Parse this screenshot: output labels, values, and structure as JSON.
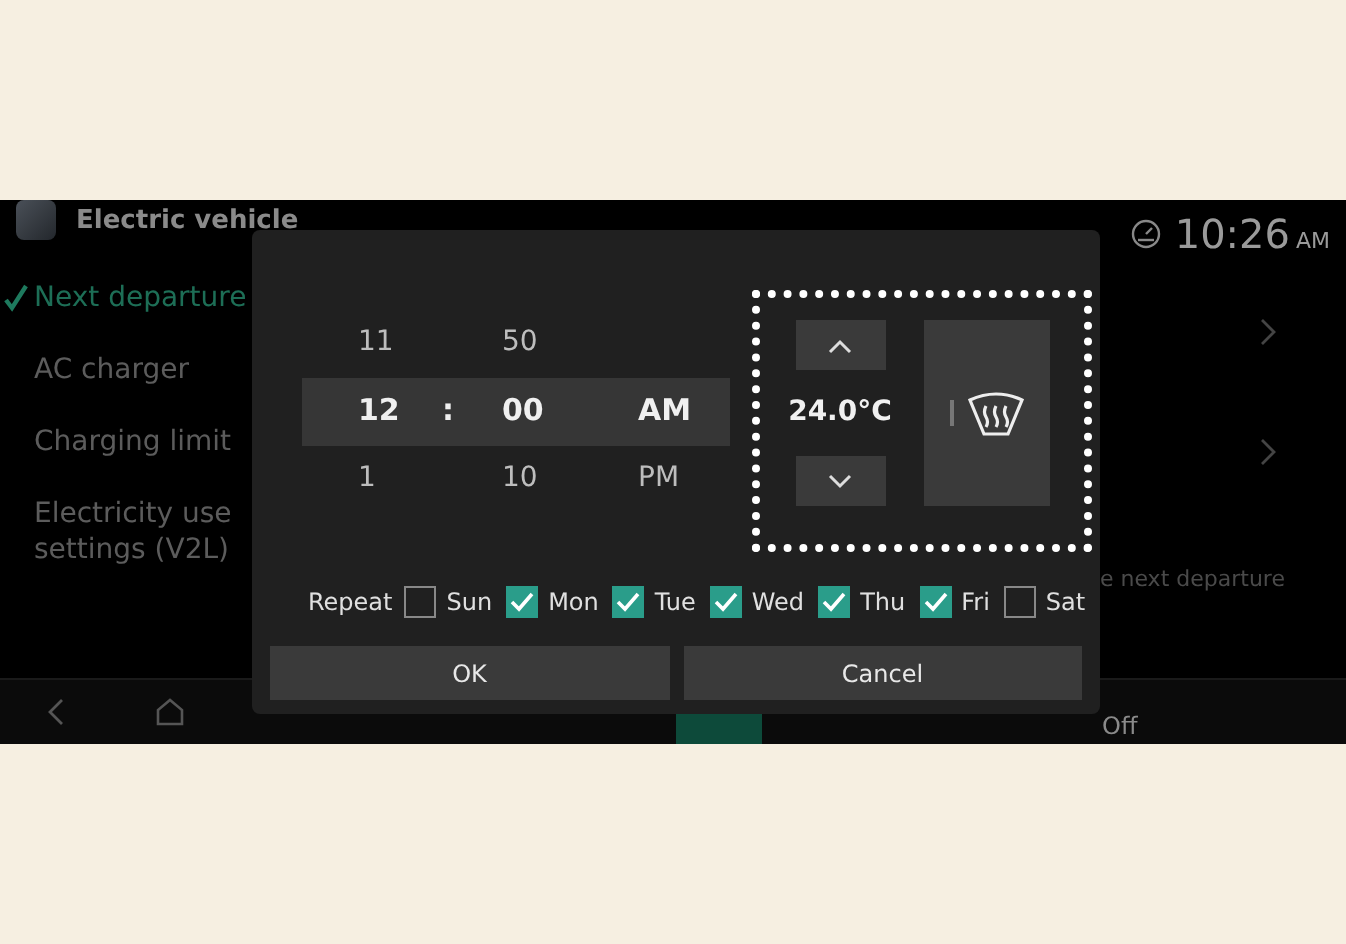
{
  "background_screen": {
    "title": "Electric vehicle",
    "clock": "10:26",
    "clock_suffix": "AM",
    "menu": [
      {
        "label": "Next departure",
        "selected": true
      },
      {
        "label": "AC charger",
        "selected": false
      },
      {
        "label": "Charging limit",
        "selected": false
      },
      {
        "label": "Electricity use settings (V2L)",
        "selected": false
      }
    ],
    "panel_note": "e next departure",
    "nav_label": "Off"
  },
  "dialog": {
    "time_picker": {
      "hour": {
        "previous": "11",
        "current": "12",
        "next": "1"
      },
      "separator": ":",
      "minute": {
        "previous": "50",
        "current": "00",
        "next": "10"
      },
      "period": {
        "current": "AM",
        "next": "PM"
      }
    },
    "climate": {
      "temperature": "24.0°C",
      "defrost": {
        "on": false
      }
    },
    "repeat": {
      "label": "Repeat",
      "days": [
        {
          "label": "Sun",
          "checked": false
        },
        {
          "label": "Mon",
          "checked": true
        },
        {
          "label": "Tue",
          "checked": true
        },
        {
          "label": "Wed",
          "checked": true
        },
        {
          "label": "Thu",
          "checked": true
        },
        {
          "label": "Fri",
          "checked": true
        },
        {
          "label": "Sat",
          "checked": false
        }
      ]
    },
    "buttons": [
      {
        "label": "OK"
      },
      {
        "label": "Cancel"
      }
    ]
  }
}
